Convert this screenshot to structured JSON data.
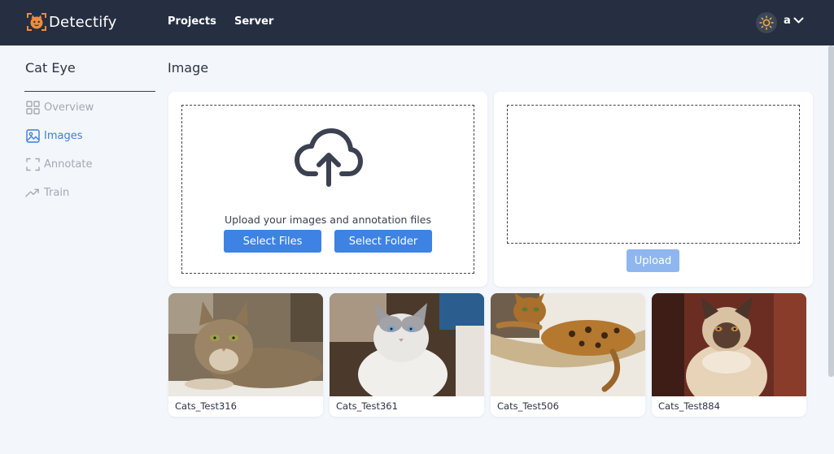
{
  "app": {
    "name": "Detectify"
  },
  "nav": {
    "projects": "Projects",
    "server": "Server"
  },
  "user": {
    "name": "a"
  },
  "sidebar": {
    "project_title": "Cat Eye",
    "items": [
      {
        "label": "Overview",
        "icon": "grid-icon",
        "active": false
      },
      {
        "label": "Images",
        "icon": "image-icon",
        "active": true
      },
      {
        "label": "Annotate",
        "icon": "focus-frame-icon",
        "active": false
      },
      {
        "label": "Train",
        "icon": "trending-up-icon",
        "active": false
      }
    ]
  },
  "main": {
    "title": "Image",
    "upload": {
      "prompt": "Upload your images and annotation files",
      "select_files": "Select Files",
      "select_folder": "Select Folder",
      "upload_button": "Upload"
    },
    "images": [
      {
        "name": "Cats_Test316"
      },
      {
        "name": "Cats_Test361"
      },
      {
        "name": "Cats_Test506"
      },
      {
        "name": "Cats_Test884"
      }
    ]
  },
  "colors": {
    "header_bg": "#262f42",
    "accent": "#3e82e4",
    "accent_disabled": "#8fb6ee",
    "brand_orange": "#f08a3c"
  }
}
